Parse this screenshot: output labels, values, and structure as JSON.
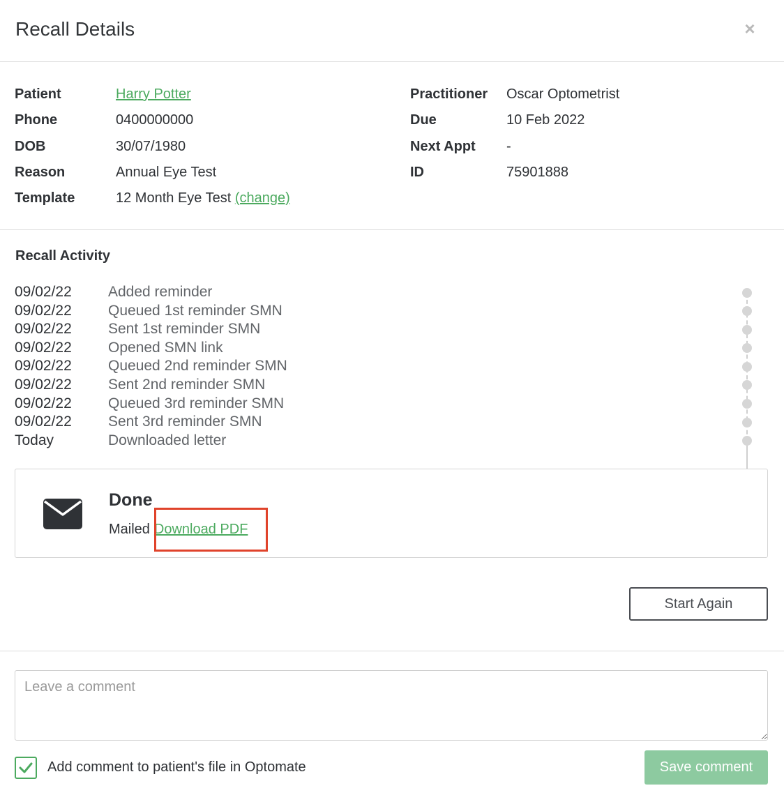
{
  "modal": {
    "title": "Recall Details",
    "close_icon": "close-icon",
    "close_glyph": "×"
  },
  "details": {
    "patient_label": "Patient",
    "patient_value": "Harry Potter",
    "phone_label": "Phone",
    "phone_value": "0400000000",
    "dob_label": "DOB",
    "dob_value": "30/07/1980",
    "reason_label": "Reason",
    "reason_value": "Annual Eye Test",
    "template_label": "Template",
    "template_value": "12 Month Eye Test",
    "template_change_link": "(change)",
    "practitioner_label": "Practitioner",
    "practitioner_value": "Oscar Optometrist",
    "due_label": "Due",
    "due_value": "10 Feb 2022",
    "next_appt_label": "Next Appt",
    "next_appt_value": "-",
    "id_label": "ID",
    "id_value": "75901888"
  },
  "activity": {
    "title": "Recall Activity",
    "items": [
      {
        "date": "09/02/22",
        "text": "Added reminder"
      },
      {
        "date": "09/02/22",
        "text": "Queued 1st reminder SMN"
      },
      {
        "date": "09/02/22",
        "text": "Sent 1st reminder SMN"
      },
      {
        "date": "09/02/22",
        "text": "Opened SMN link"
      },
      {
        "date": "09/02/22",
        "text": "Queued 2nd reminder SMN"
      },
      {
        "date": "09/02/22",
        "text": "Sent 2nd reminder SMN"
      },
      {
        "date": "09/02/22",
        "text": "Queued 3rd reminder SMN"
      },
      {
        "date": "09/02/22",
        "text": "Sent 3rd reminder SMN"
      },
      {
        "date": "Today",
        "text": "Downloaded letter"
      }
    ]
  },
  "done": {
    "icon": "envelope-icon",
    "title": "Done",
    "status": "Mailed",
    "download_link": "Download PDF"
  },
  "actions": {
    "start_again": "Start Again"
  },
  "comment": {
    "placeholder": "Leave a comment",
    "value": "",
    "checkbox_checked": true,
    "checkbox_label": "Add comment to patient's file in Optomate",
    "save_label": "Save comment"
  },
  "colors": {
    "link": "#4caa5f",
    "save_button": "#8dcaa0",
    "highlight": "#e0432b"
  }
}
